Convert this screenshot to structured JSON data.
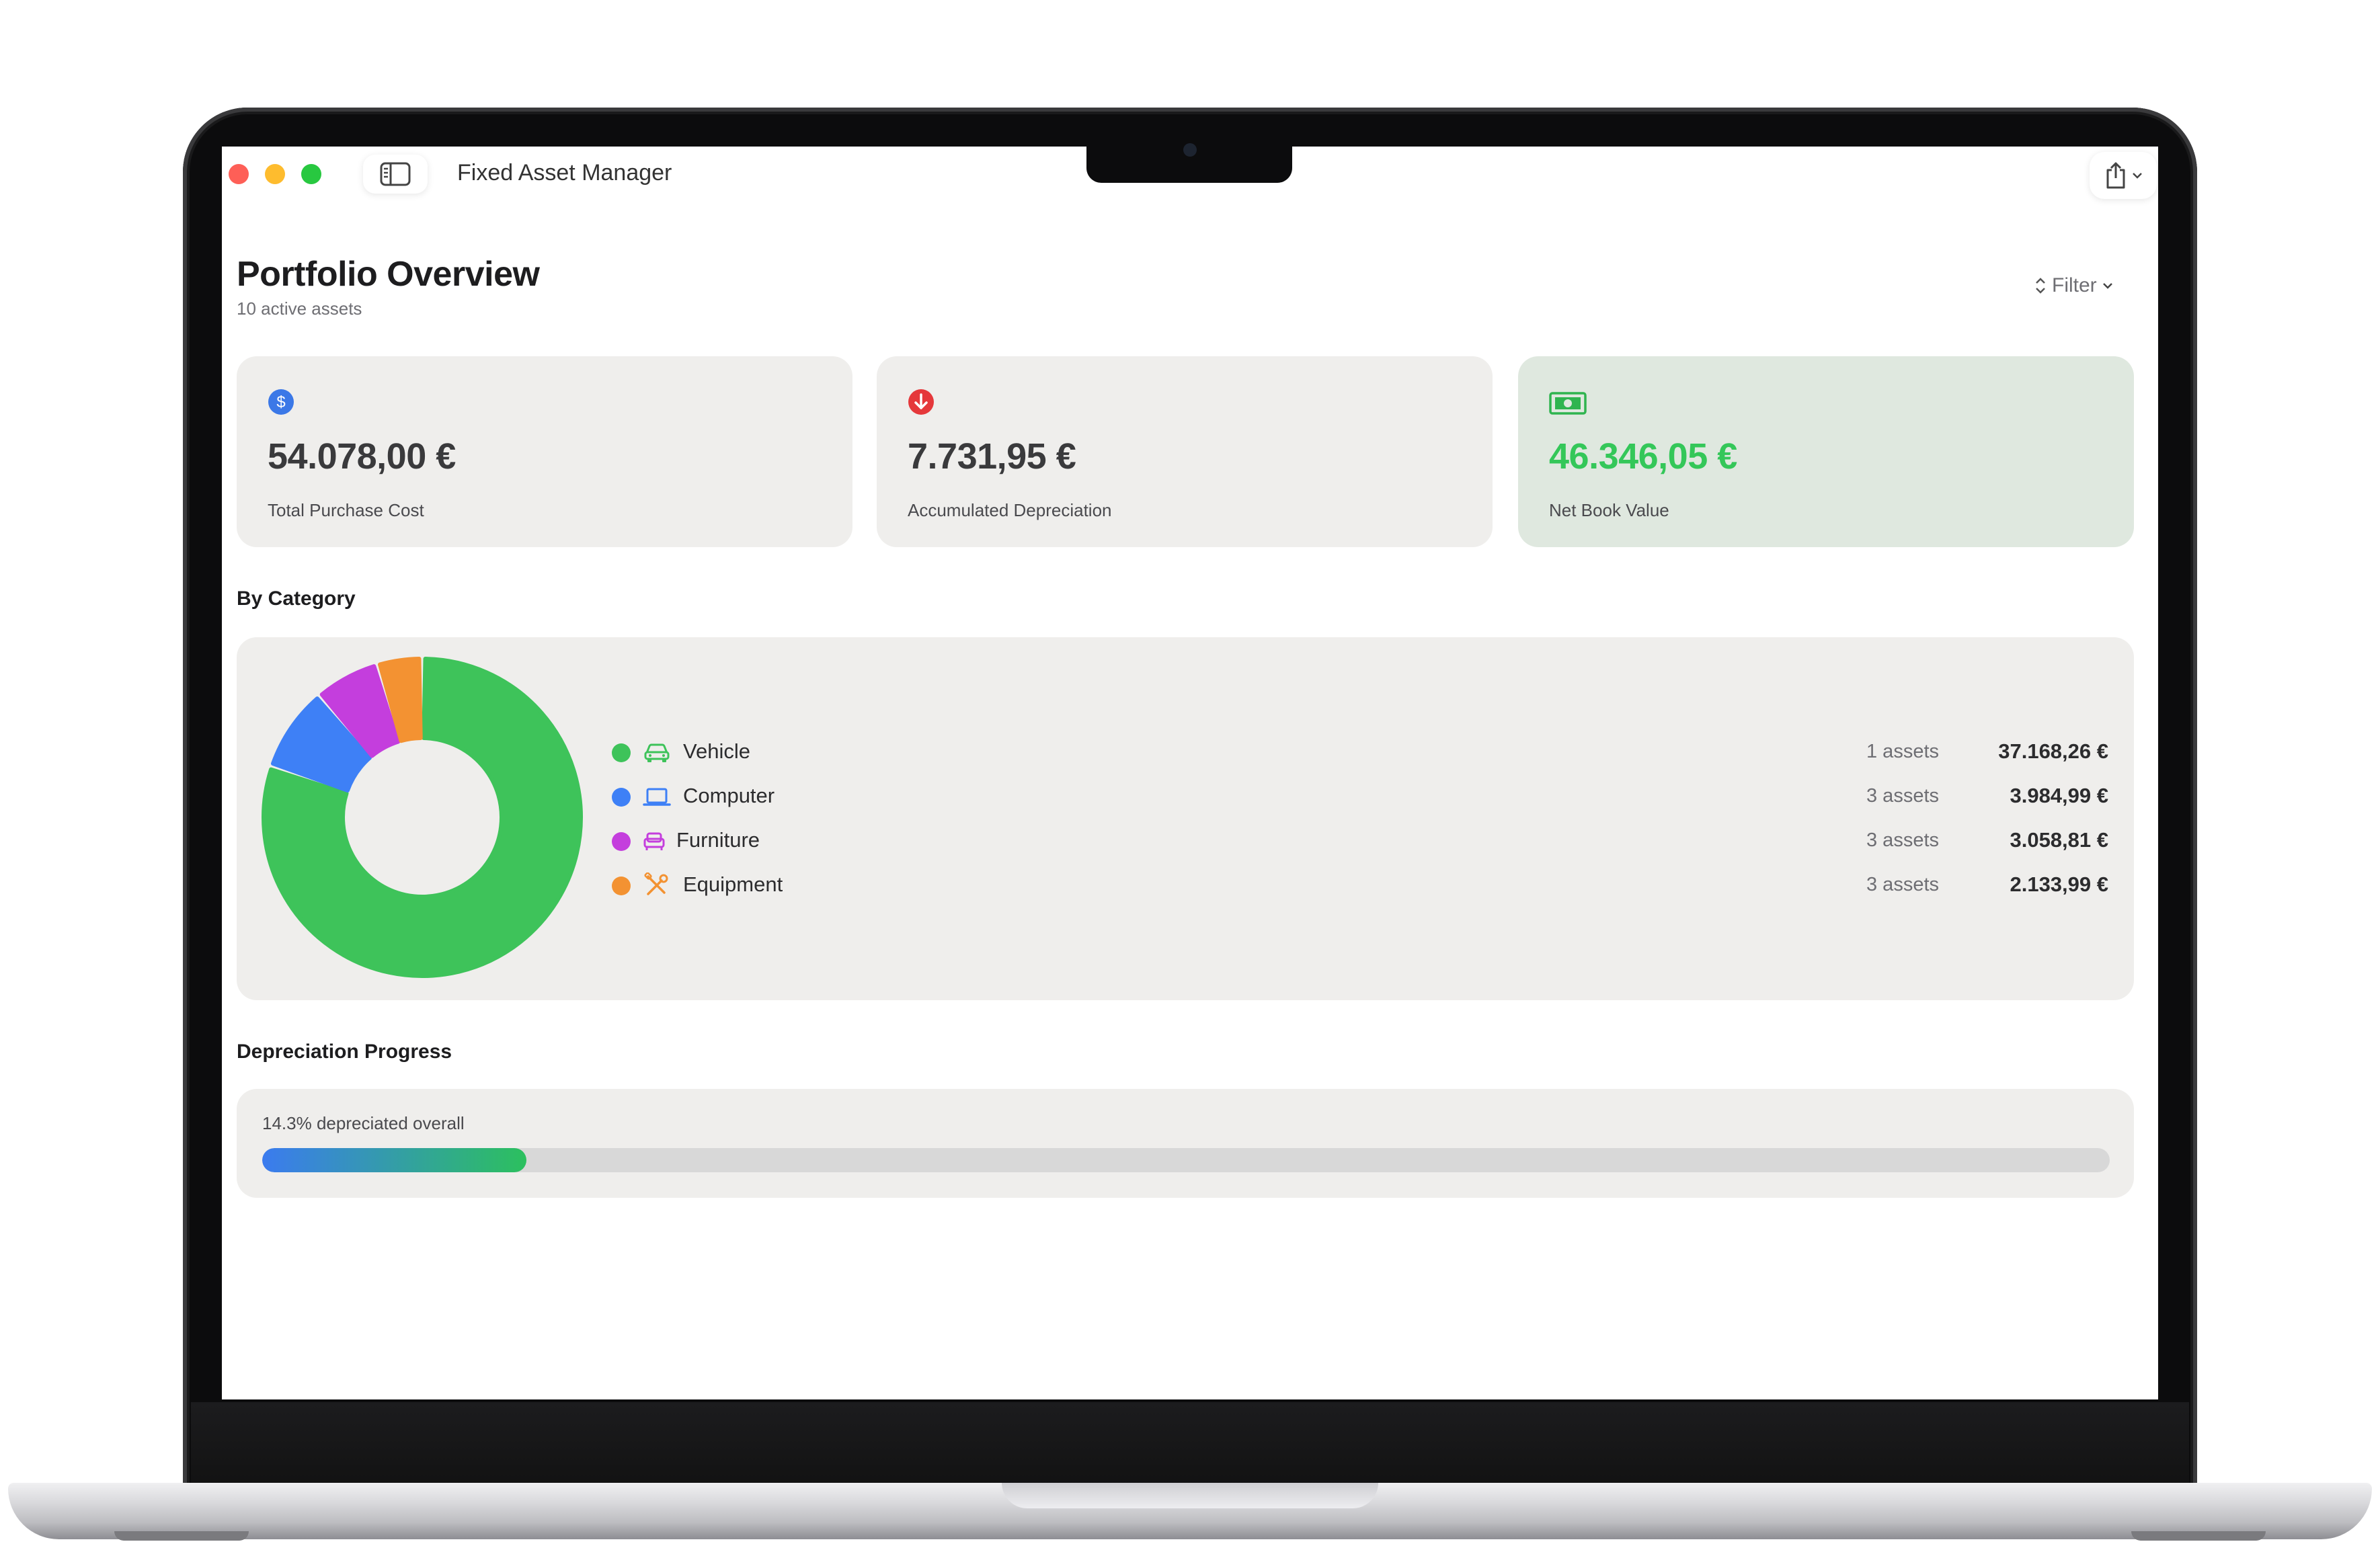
{
  "window": {
    "title": "Fixed Asset Manager"
  },
  "colors": {
    "close": "#fe5f57",
    "minimize": "#febc2e",
    "zoom": "#28c840",
    "accent_green": "#34c759"
  },
  "header": {
    "title": "Portfolio Overview",
    "subtitle": "10 active assets",
    "filter_label": "Filter"
  },
  "summary": [
    {
      "value": "54.078,00 €",
      "label": "Total Purchase Cost",
      "icon": "dollar-circle-icon",
      "color": "#3b78e7"
    },
    {
      "value": "7.731,95 €",
      "label": "Accumulated Depreciation",
      "icon": "arrow-down-circle-icon",
      "color": "#e5383b"
    },
    {
      "value": "46.346,05 €",
      "label": "Net Book Value",
      "icon": "banknote-icon",
      "color": "#34c759"
    }
  ],
  "sections": {
    "category": "By Category",
    "progress": "Depreciation Progress"
  },
  "categories": [
    {
      "name": "Vehicle",
      "count": "1 assets",
      "amount": "37.168,26 €",
      "value": 37168.26,
      "color": "#3ec35a",
      "icon": "car-icon"
    },
    {
      "name": "Computer",
      "count": "3 assets",
      "amount": "3.984,99 €",
      "value": 3984.99,
      "color": "#3e80f6",
      "icon": "laptop-icon"
    },
    {
      "name": "Furniture",
      "count": "3 assets",
      "amount": "3.058,81 €",
      "value": 3058.81,
      "color": "#c43edd",
      "icon": "sofa-icon"
    },
    {
      "name": "Equipment",
      "count": "3 assets",
      "amount": "2.133,99 €",
      "value": 2133.99,
      "color": "#f39232",
      "icon": "wrench-screwdriver-icon"
    }
  ],
  "progress": {
    "text": "14.3% depreciated overall",
    "fraction": 0.143
  }
}
